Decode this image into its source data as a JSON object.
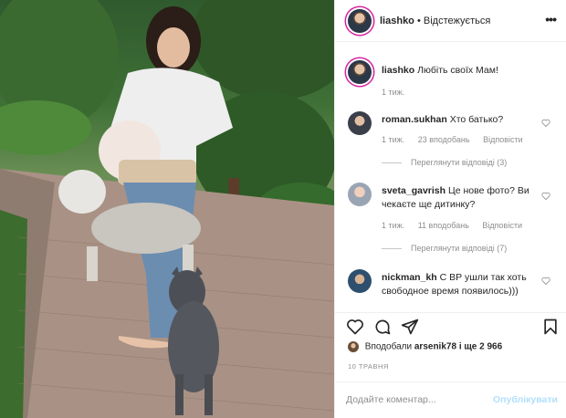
{
  "post": {
    "photo_alt": "",
    "author": "liashko",
    "separator": "•",
    "follow_status": "Відстежується",
    "caption": "Любіть своїх Мам!",
    "caption_time": "1 тиж."
  },
  "comments": [
    {
      "user": "roman.sukhan",
      "text": "Хто батько?",
      "time": "1 тиж.",
      "likes": "23 вподобань",
      "reply": "Відповісти",
      "view_replies": "Переглянути відповіді (3)"
    },
    {
      "user": "sveta_gavrish",
      "text": "Це нове фото? Ви чекаєте ще дитинку?",
      "time": "1 тиж.",
      "likes": "11 вподобань",
      "reply": "Відповісти",
      "view_replies": "Переглянути відповіді (7)"
    },
    {
      "user": "nickman_kh",
      "text": "С ВР ушли так хоть свободное время появилось)))"
    }
  ],
  "likes": {
    "prefix": "Вподобали",
    "user": "arsenik78",
    "rest": "і ще 2 966"
  },
  "date": "10 ТРАВНЯ",
  "comment_box": {
    "placeholder": "Додайте коментар...",
    "publish": "Опублікувати"
  },
  "colors": {
    "link_blue": "#0095f6",
    "publish_disabled": "#b2dffc",
    "meta_gray": "#8e8e8e",
    "story_ring": "#d6249f"
  },
  "icons": [
    "more-icon",
    "heart-icon",
    "comment-icon",
    "share-icon",
    "bookmark-icon"
  ]
}
